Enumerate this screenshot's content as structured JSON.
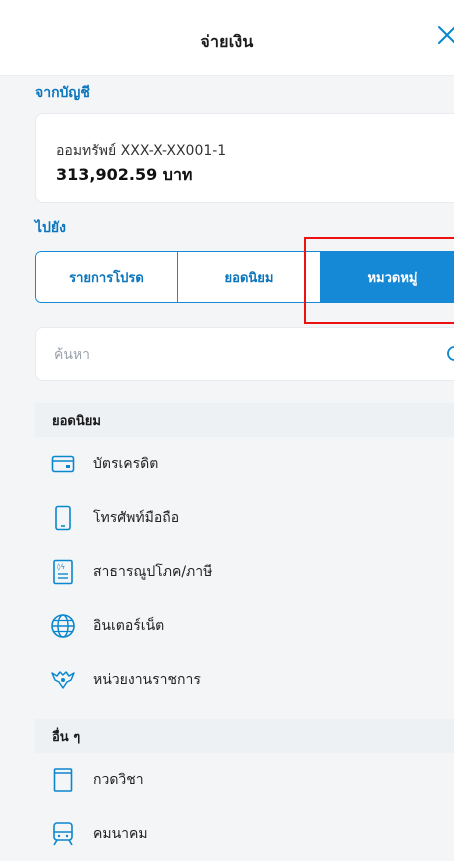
{
  "header": {
    "title": "จ่ายเงิน"
  },
  "from": {
    "label": "จากบัญชี",
    "account_name": "ออมทรัพย์ XXX-X-XX001-1",
    "balance": "313,902.59 บาท"
  },
  "to": {
    "label": "ไปยัง"
  },
  "tabs": [
    {
      "label": "รายการโปรด"
    },
    {
      "label": "ยอดนิยม"
    },
    {
      "label": "หมวดหมู่",
      "active": true
    }
  ],
  "search": {
    "placeholder": "ค้นหา"
  },
  "groups": [
    {
      "title": "ยอดนิยม",
      "items": [
        {
          "label": "บัตรเครดิต",
          "icon": "credit-card-icon"
        },
        {
          "label": "โทรศัพท์มือถือ",
          "icon": "mobile-phone-icon"
        },
        {
          "label": "สาธารณูปโภค/ภาษี",
          "icon": "utility-bill-icon"
        },
        {
          "label": "อินเตอร์เน็ต",
          "icon": "globe-icon"
        },
        {
          "label": "หน่วยงานราชการ",
          "icon": "government-emblem-icon"
        }
      ]
    },
    {
      "title": "อื่น ๆ",
      "items": [
        {
          "label": "กวดวิชา",
          "icon": "book-icon"
        },
        {
          "label": "คมนาคม",
          "icon": "train-icon"
        }
      ]
    }
  ],
  "colors": {
    "accent": "#1589d6",
    "highlight": "#e11111"
  }
}
